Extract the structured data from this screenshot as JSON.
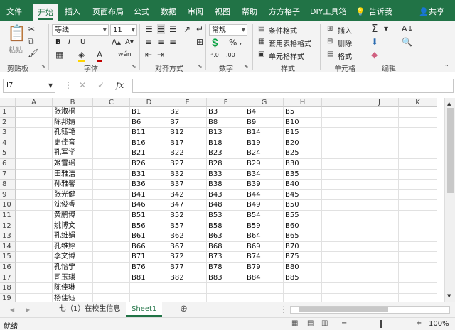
{
  "ribbon_tabs": [
    "文件",
    "开始",
    "插入",
    "页面布局",
    "公式",
    "数据",
    "审阅",
    "视图",
    "帮助",
    "方方格子",
    "DIY工具箱"
  ],
  "tell_me": "告诉我",
  "share": "共享",
  "clipboard": {
    "paste": "粘贴",
    "label": "剪贴板"
  },
  "font": {
    "name": "等线",
    "size": "11",
    "bold": "B",
    "italic": "I",
    "underline": "U",
    "label": "字体"
  },
  "alignment": {
    "label": "对齐方式"
  },
  "number": {
    "format": "常规",
    "label": "数字"
  },
  "styles": {
    "conditional": "条件格式",
    "table": "套用表格格式",
    "cell": "单元格样式",
    "label": "样式"
  },
  "cells": {
    "insert": "插入",
    "delete": "删除",
    "format": "格式",
    "label": "单元格"
  },
  "editing": {
    "label": "编辑"
  },
  "formula_bar": {
    "name_box": "I7",
    "fx": "fx",
    "value": ""
  },
  "columns": [
    "A",
    "B",
    "C",
    "D",
    "E",
    "F",
    "G",
    "H",
    "I",
    "J",
    "K"
  ],
  "rows": [
    "1",
    "2",
    "3",
    "4",
    "5",
    "6",
    "7",
    "8",
    "9",
    "10",
    "11",
    "12",
    "13",
    "14",
    "15",
    "16",
    "17",
    "18",
    "19"
  ],
  "names": [
    "张淑桐",
    "陈邦婧",
    "孔钰艳",
    "史佳音",
    "孔军学",
    "姬雪瑶",
    "田雅洁",
    "孙雅馨",
    "张光健",
    "沈俊睿",
    "黄鹏博",
    "姚博文",
    "孔维娟",
    "孔维婷",
    "李文博",
    "孔怡宁",
    "司玉琪",
    "陈佳琳",
    "杨佳钰"
  ],
  "codes": [
    [
      "B1",
      "B2",
      "B3",
      "B4",
      "B5"
    ],
    [
      "B6",
      "B7",
      "B8",
      "B9",
      "B10"
    ],
    [
      "B11",
      "B12",
      "B13",
      "B14",
      "B15"
    ],
    [
      "B16",
      "B17",
      "B18",
      "B19",
      "B20"
    ],
    [
      "B21",
      "B22",
      "B23",
      "B24",
      "B25"
    ],
    [
      "B26",
      "B27",
      "B28",
      "B29",
      "B30"
    ],
    [
      "B31",
      "B32",
      "B33",
      "B34",
      "B35"
    ],
    [
      "B36",
      "B37",
      "B38",
      "B39",
      "B40"
    ],
    [
      "B41",
      "B42",
      "B43",
      "B44",
      "B45"
    ],
    [
      "B46",
      "B47",
      "B48",
      "B49",
      "B50"
    ],
    [
      "B51",
      "B52",
      "B53",
      "B54",
      "B55"
    ],
    [
      "B56",
      "B57",
      "B58",
      "B59",
      "B60"
    ],
    [
      "B61",
      "B62",
      "B63",
      "B64",
      "B65"
    ],
    [
      "B66",
      "B67",
      "B68",
      "B69",
      "B70"
    ],
    [
      "B71",
      "B72",
      "B73",
      "B74",
      "B75"
    ],
    [
      "B76",
      "B77",
      "B78",
      "B79",
      "B80"
    ],
    [
      "B81",
      "B82",
      "B83",
      "B84",
      "B85"
    ]
  ],
  "sheet_tabs": [
    "七（1）在校生信息",
    "Sheet1"
  ],
  "active_sheet": "Sheet1",
  "status": {
    "ready": "就绪",
    "zoom": "100%"
  },
  "colors": {
    "accent": "#217346",
    "font_color": "#c00000",
    "highlight": "#ffd400"
  },
  "icons": [
    "cut-icon",
    "copy-icon",
    "format-painter-icon",
    "lightbulb-icon",
    "user-icon",
    "sum-icon",
    "fill-icon",
    "clear-icon",
    "add-sheet-icon",
    "fx-icon"
  ]
}
